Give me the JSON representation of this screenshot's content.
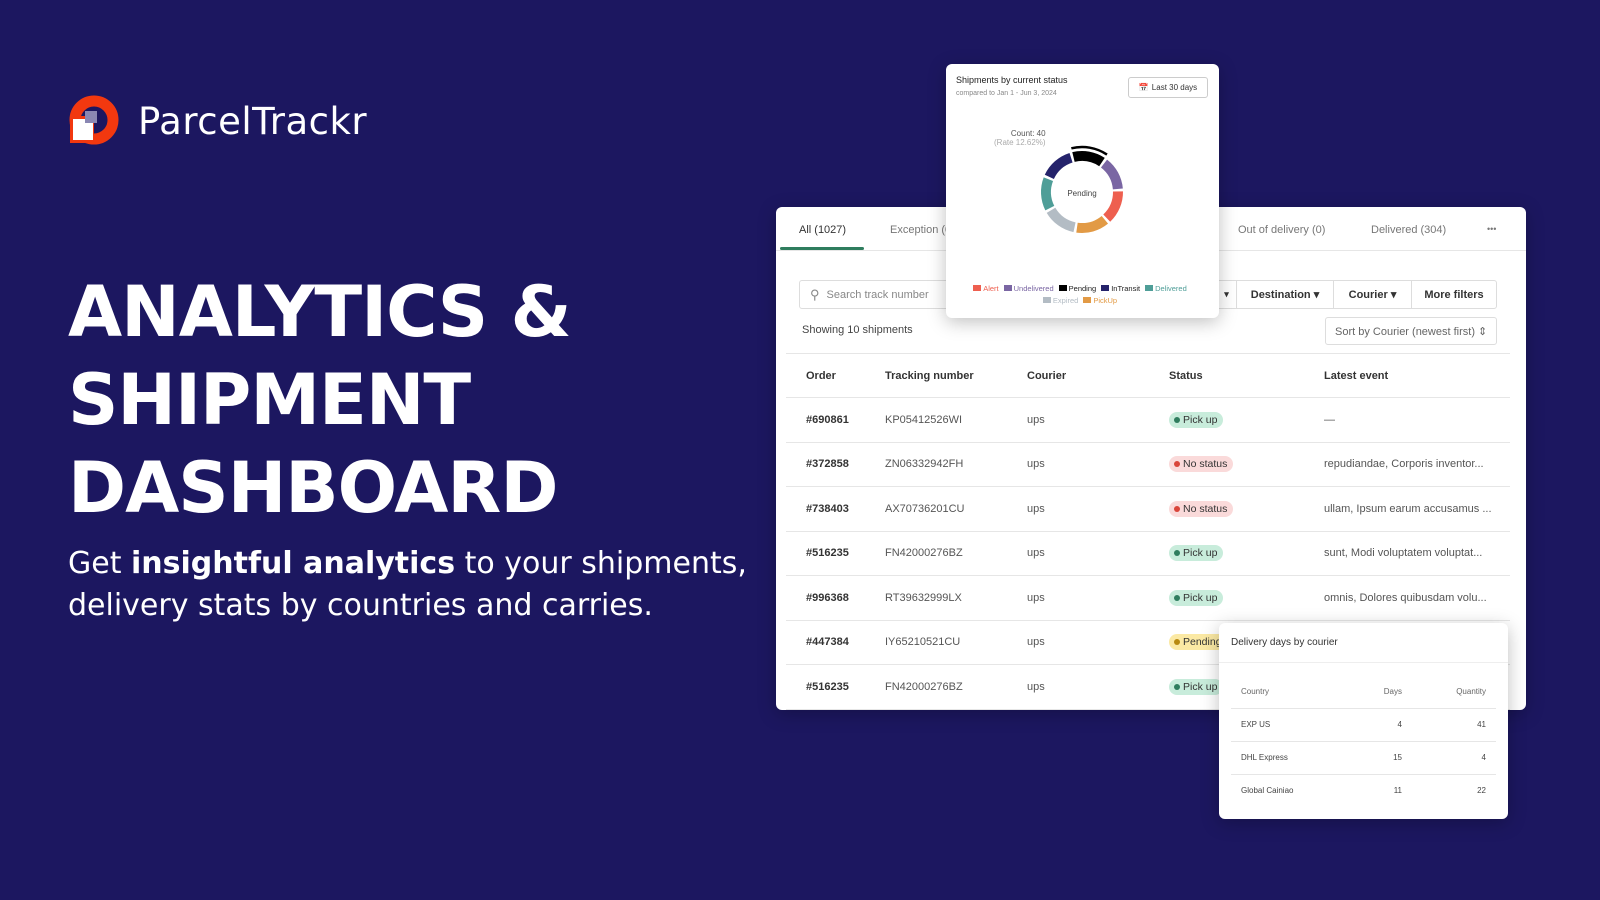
{
  "brand": {
    "name": "ParcelTrackr"
  },
  "hero": {
    "line1": "ANALYTICS &",
    "line2": "SHIPMENT",
    "line3": "DASHBOARD",
    "sub_pre": "Get ",
    "sub_bold": "insightful analytics",
    "sub_post": " to your shipments, delivery stats by countries and carries."
  },
  "tabs": [
    {
      "label": "All (1027)"
    },
    {
      "label": "Exception (0)"
    },
    {
      "label": "Out of delivery (0)"
    },
    {
      "label": "Delivered (304)"
    },
    {
      "label": "•••"
    }
  ],
  "filters": {
    "search_placeholder": "Search track number",
    "hidden_caret": "▾",
    "destination": "Destination ▾",
    "courier": "Courier ▾",
    "more": "More filters"
  },
  "showing": "Showing 10 shipments",
  "sort": "Sort by Courier (newest first) ⇕",
  "table": {
    "headers": [
      "Order",
      "Tracking number",
      "Courier",
      "Status",
      "Latest event"
    ],
    "rows": [
      [
        "#690861",
        "KP05412526WI",
        "ups",
        "Pick up",
        "—"
      ],
      [
        "#372858",
        "ZN06332942FH",
        "ups",
        "No status",
        "repudiandae, Corporis inventor..."
      ],
      [
        "#738403",
        "AX70736201CU",
        "ups",
        "No status",
        "ullam, Ipsum earum accusamus ..."
      ],
      [
        "#516235",
        "FN42000276BZ",
        "ups",
        "Pick up",
        "sunt, Modi voluptatem voluptat..."
      ],
      [
        "#996368",
        "RT39632999LX",
        "ups",
        "Pick up",
        "omnis, Dolores quibusdam volu..."
      ],
      [
        "#447384",
        "IY65210521CU",
        "ups",
        "Pending",
        ""
      ],
      [
        "#516235",
        "FN42000276BZ",
        "ups",
        "Pick up",
        ""
      ]
    ]
  },
  "status_colors": {
    "Pick up": [
      "#c8ecdb",
      "#2f7d5e"
    ],
    "No status": [
      "#fadada",
      "#d9453a"
    ],
    "Pending": [
      "#fbe9a4",
      "#b88a10"
    ]
  },
  "chart_data": {
    "type": "pie",
    "title": "Shipments by current status",
    "subtitle": "compared to Jan 1 - Jun 3, 2024",
    "range_button": "Last 30 days",
    "center_label": "Pending",
    "tooltip": {
      "count": "Count: 40",
      "rate": "(Rate 12.62%)"
    },
    "segments_clockwise_from_top": [
      "Pending",
      "Undelivered",
      "Alert",
      "PickUp",
      "Expired",
      "Delivered",
      "InTransit"
    ],
    "legend": [
      {
        "name": "Alert",
        "color": "#ee5f4f"
      },
      {
        "name": "Undelivered",
        "color": "#7a66a3"
      },
      {
        "name": "Pending",
        "color": "#000000"
      },
      {
        "name": "InTransit",
        "color": "#25236b"
      },
      {
        "name": "Delivered",
        "color": "#4f9e98"
      },
      {
        "name": "Expired",
        "color": "#b3bcc4"
      },
      {
        "name": "PickUp",
        "color": "#e29a45"
      }
    ],
    "legend_placement": "bottom"
  },
  "delivery": {
    "title": "Delivery days by courier",
    "headers": [
      "Country",
      "Days",
      "Quantity"
    ],
    "rows": [
      [
        "EXP US",
        "4",
        "41"
      ],
      [
        "DHL Express",
        "15",
        "4"
      ],
      [
        "Global Cainiao",
        "11",
        "22"
      ]
    ]
  }
}
